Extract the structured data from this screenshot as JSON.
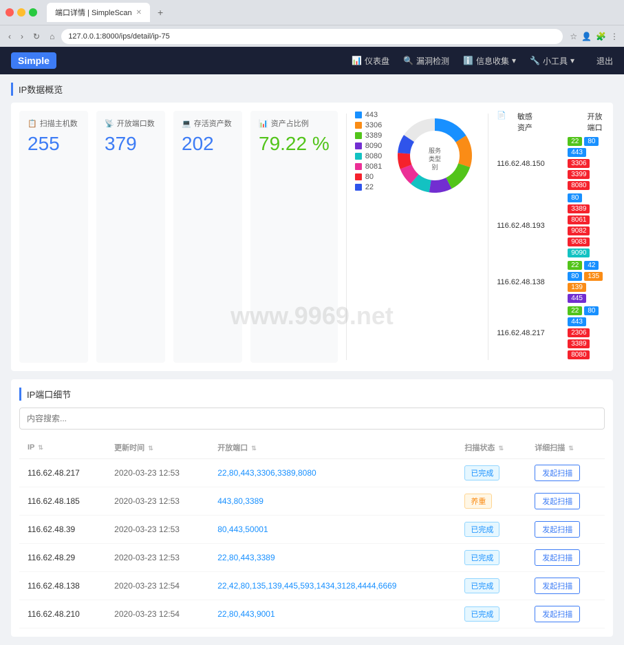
{
  "browser": {
    "tab_title": "端口详情 | SimpleScan",
    "url": "127.0.0.1:8000/ips/detail/ip-75",
    "new_tab_label": "+"
  },
  "header": {
    "logo": "Simple",
    "nav_items": [
      {
        "label": "仪表盘",
        "icon": "📊"
      },
      {
        "label": "漏洞检测",
        "icon": "🔍"
      },
      {
        "label": "信息收集",
        "icon": "ℹ",
        "has_dropdown": true
      },
      {
        "label": "小工具",
        "icon": "🔧",
        "has_dropdown": true
      }
    ],
    "exit_label": "退出"
  },
  "stats_section": {
    "title": "IP数据概览",
    "cards": [
      {
        "label": "扫描主机数",
        "value": "255",
        "color": "blue"
      },
      {
        "label": "开放端口数",
        "value": "379",
        "color": "blue"
      },
      {
        "label": "存活资产数",
        "value": "202",
        "color": "blue"
      },
      {
        "label": "资产占比例",
        "value": "79.22 %",
        "color": "green"
      }
    ],
    "legend": [
      {
        "color": "#1890ff",
        "value": "443"
      },
      {
        "color": "#fa8c16",
        "value": "3306"
      },
      {
        "color": "#52c41a",
        "value": "3389"
      },
      {
        "color": "#722ed1",
        "value": "8090"
      },
      {
        "color": "#13c2c2",
        "value": "8080"
      },
      {
        "color": "#eb2f96",
        "value": "8081"
      },
      {
        "color": "#f5222d",
        "value": "80"
      },
      {
        "color": "#2f54eb",
        "value": "22"
      }
    ],
    "sensitive_title": "敏感资产",
    "sensitive_col": "开放端口",
    "sensitive_rows": [
      {
        "ip": "116.62.48.150",
        "tags": [
          {
            "value": "22",
            "class": "tag-green"
          },
          {
            "value": "80",
            "class": "tag-blue"
          },
          {
            "value": "443",
            "class": "tag-blue"
          },
          {
            "value": "3306",
            "class": "tag-red"
          },
          {
            "value": "3399",
            "class": "tag-red"
          },
          {
            "value": "8080",
            "class": "tag-red"
          }
        ]
      },
      {
        "ip": "116.62.48.193",
        "tags": [
          {
            "value": "80",
            "class": "tag-blue"
          },
          {
            "value": "3389",
            "class": "tag-red"
          },
          {
            "value": "8061",
            "class": "tag-red"
          },
          {
            "value": "9082",
            "class": "tag-red"
          },
          {
            "value": "9083",
            "class": "tag-red"
          },
          {
            "value": "9090",
            "class": "tag-cyan"
          }
        ]
      },
      {
        "ip": "116.62.48.138",
        "tags": [
          {
            "value": "22",
            "class": "tag-green"
          },
          {
            "value": "42",
            "class": "tag-blue"
          },
          {
            "value": "80",
            "class": "tag-blue"
          },
          {
            "value": "135",
            "class": "tag-orange"
          },
          {
            "value": "139",
            "class": "tag-orange"
          },
          {
            "value": "445",
            "class": "tag-purple"
          }
        ]
      },
      {
        "ip": "116.62.48.217",
        "tags": [
          {
            "value": "22",
            "class": "tag-green"
          },
          {
            "value": "80",
            "class": "tag-blue"
          },
          {
            "value": "443",
            "class": "tag-blue"
          },
          {
            "value": "2306",
            "class": "tag-red"
          },
          {
            "value": "3389",
            "class": "tag-red"
          },
          {
            "value": "8080",
            "class": "tag-red"
          }
        ]
      }
    ]
  },
  "table_section": {
    "title": "IP端口细节",
    "search_placeholder": "内容搜索...",
    "columns": [
      "IP",
      "更新时间",
      "开放端口",
      "扫描状态",
      "详细扫描"
    ],
    "rows": [
      {
        "ip": "116.62.48.217",
        "time": "2020-03-23 12:53",
        "ports": "22,80,443,3306,3389,8080",
        "status": "已完成",
        "status_type": "done",
        "btn": "发起扫描"
      },
      {
        "ip": "116.62.48.185",
        "time": "2020-03-23 12:53",
        "ports": "443,80,3389",
        "status": "养重",
        "status_type": "queued",
        "btn": "发起扫描"
      },
      {
        "ip": "116.62.48.39",
        "time": "2020-03-23 12:53",
        "ports": "80,443,50001",
        "status": "已完成",
        "status_type": "done",
        "btn": "发起扫描"
      },
      {
        "ip": "116.62.48.29",
        "time": "2020-03-23 12:53",
        "ports": "22,80,443,3389",
        "status": "已完成",
        "status_type": "done",
        "btn": "发起扫描"
      },
      {
        "ip": "116.62.48.138",
        "time": "2020-03-23 12:54",
        "ports": "22,42,80,135,139,445,593,1434,3128,4444,6669",
        "status": "已完成",
        "status_type": "done",
        "btn": "发起扫描"
      },
      {
        "ip": "116.62.48.210",
        "time": "2020-03-23 12:54",
        "ports": "22,80,443,9001",
        "status": "已完成",
        "status_type": "done",
        "btn": "发起扫描"
      }
    ]
  },
  "watermark": "www.9969.net"
}
